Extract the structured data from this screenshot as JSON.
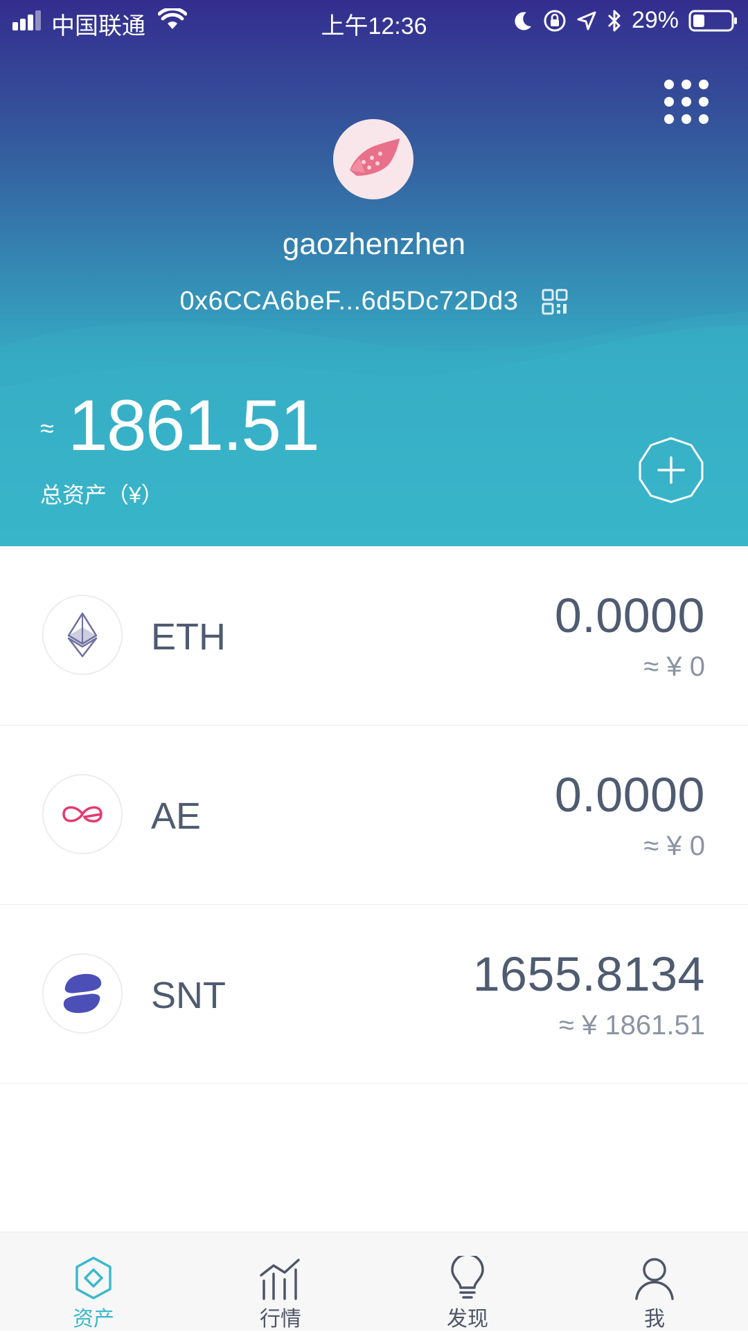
{
  "status_bar": {
    "carrier": "中国联通",
    "time": "上午12:36",
    "battery": "29%"
  },
  "header": {
    "menu_icon": "grid-menu-icon",
    "username": "gaozhenzhen",
    "address": "0x6CCA6beF...6d5Dc72Dd3",
    "qr_icon": "qr-code-icon",
    "total_approx": "≈",
    "total_value": "1861.51",
    "total_label": "总资产（¥）",
    "add_icon": "add-token-icon"
  },
  "tokens": [
    {
      "symbol": "ETH",
      "amount": "0.0000",
      "fiat": "≈  ¥  0",
      "icon": "ethereum-icon"
    },
    {
      "symbol": "AE",
      "amount": "0.0000",
      "fiat": "≈  ¥  0",
      "icon": "aeternity-icon"
    },
    {
      "symbol": "SNT",
      "amount": "1655.8134",
      "fiat": "≈  ¥  1861.51",
      "icon": "status-icon"
    }
  ],
  "tab_bar": {
    "tabs": [
      {
        "label": "资产",
        "icon": "wallet-diamond-icon",
        "active": true
      },
      {
        "label": "行情",
        "icon": "market-chart-icon",
        "active": false
      },
      {
        "label": "发现",
        "icon": "lightbulb-icon",
        "active": false
      },
      {
        "label": "我",
        "icon": "person-icon",
        "active": false
      }
    ]
  },
  "colors": {
    "accent": "#3ab9cb",
    "header_top": "#342d8f",
    "text_primary": "#4e5b70",
    "text_secondary": "#8b94a3"
  }
}
